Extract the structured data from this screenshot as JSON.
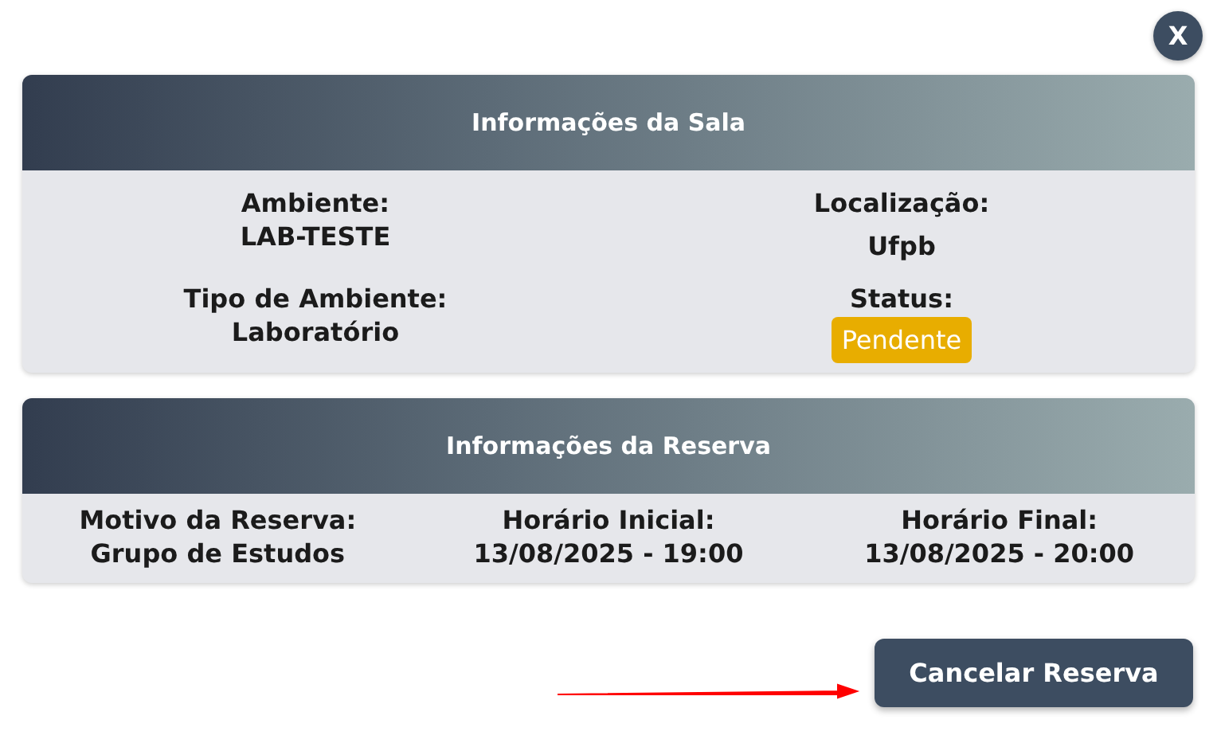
{
  "close_button": {
    "label": "X"
  },
  "sections": [
    {
      "title": "Informações da Sala",
      "fields": [
        {
          "label": "Ambiente:",
          "value": "LAB-TESTE",
          "kind": "text"
        },
        {
          "label": "Localização:",
          "value": "Ufpb",
          "kind": "text"
        },
        {
          "label": "Tipo de Ambiente:",
          "value": "Laboratório",
          "kind": "text"
        },
        {
          "label": "Status:",
          "value": "Pendente",
          "kind": "badge"
        }
      ]
    },
    {
      "title": "Informações da Reserva",
      "fields": [
        {
          "label": "Motivo da Reserva:",
          "value": "Grupo de Estudos",
          "kind": "text"
        },
        {
          "label": "Horário Inicial:",
          "value": "13/08/2025 - 19:00",
          "kind": "text"
        },
        {
          "label": "Horário Final:",
          "value": "13/08/2025 - 20:00",
          "kind": "text"
        }
      ]
    }
  ],
  "action_button": {
    "label": "Cancelar Reserva"
  }
}
